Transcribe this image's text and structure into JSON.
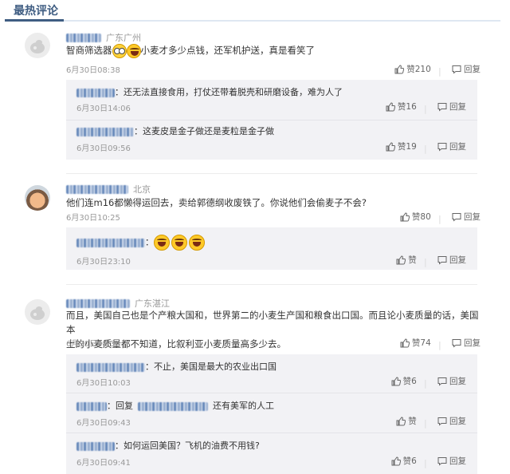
{
  "header": {
    "title": "最热评论"
  },
  "actions": {
    "like": "赞",
    "reply": "回复"
  },
  "comments": [
    {
      "location": "广东广州",
      "text_before_emoji": "智商筛选器",
      "text_after_emoji": "小麦才多少点钱，还军机护送，真是看笑了",
      "time": "6月30日08:38",
      "likes": "赞210",
      "replies": [
        {
          "text": "：还无法直接食用，打仗还带着脱壳和研磨设备，难为人了",
          "time": "6月30日14:06",
          "likes": "赞16"
        },
        {
          "text": "：这麦皮是金子做还是麦粒是金子做",
          "time": "6月30日09:56",
          "likes": "赞19"
        }
      ]
    },
    {
      "location": "北京",
      "text": "他们连m16都懒得运回去，卖给郭德纲收废铁了。你说他们会偷麦子不会?",
      "time": "6月30日10:25",
      "likes": "赞80",
      "replies": [
        {
          "text": "：",
          "time": "6月30日23:10",
          "likes": "赞"
        }
      ]
    },
    {
      "location": "广东湛江",
      "text_line1": "而且，美国自己也是个产粮大国和，世界第二的小麦生产国和粮食出口国。而且论小麦质量的话，美国本",
      "text_line2": "土的小麦质量都不知道，比叙利亚小麦质量高多少去。",
      "time": "6月30日08:38",
      "likes": "赞74",
      "replies": [
        {
          "text": "：不止，美国是最大的农业出口国",
          "time": "6月30日10:03",
          "likes": "赞6"
        },
        {
          "prefix": "：回复",
          "text": "还有美军的人工",
          "time": "6月30日09:43",
          "likes": "赞"
        },
        {
          "text": "：如何运回美国？飞机的油费不用钱?",
          "time": "6月30日09:41",
          "likes": "赞6"
        }
      ]
    }
  ]
}
